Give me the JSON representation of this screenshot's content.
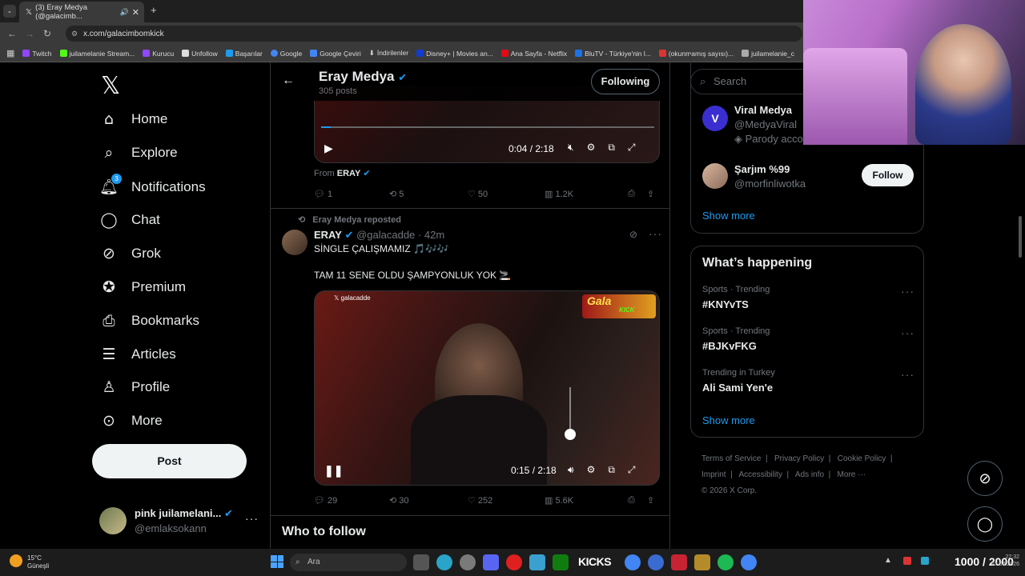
{
  "browser": {
    "tab_title": "(3) Eray Medya (@galacimb...",
    "url": "x.com/galacimbomkick",
    "bookmarks": [
      "Twitch",
      "juilamelanie Stream...",
      "Kurucu",
      "Unfollow",
      "Başarılar",
      "Google",
      "Google Çeviri",
      "İndirilenler",
      "Disney+ | Movies an...",
      "Ana Sayfa - Netflix",
      "BluTV - Türkiye'nin l...",
      "(okunmamış sayısı)...",
      "juilamelanie_c"
    ]
  },
  "sidebar": {
    "items": [
      {
        "label": "Home",
        "icon": "home-icon"
      },
      {
        "label": "Explore",
        "icon": "search-icon"
      },
      {
        "label": "Notifications",
        "icon": "bell-icon",
        "badge": "3"
      },
      {
        "label": "Chat",
        "icon": "chat-icon"
      },
      {
        "label": "Grok",
        "icon": "grok-icon"
      },
      {
        "label": "Premium",
        "icon": "premium-icon"
      },
      {
        "label": "Bookmarks",
        "icon": "bookmark-icon"
      },
      {
        "label": "Articles",
        "icon": "article-icon"
      },
      {
        "label": "Profile",
        "icon": "profile-icon"
      },
      {
        "label": "More",
        "icon": "more-icon"
      }
    ],
    "post_label": "Post",
    "account": {
      "name": "pink juilamelani...",
      "handle": "@emlaksokann"
    }
  },
  "header": {
    "name": "Eray Medya",
    "posts": "305 posts",
    "following_label": "Following"
  },
  "tweet1": {
    "video_time": "0:04 / 2:18",
    "from_label": "From",
    "from_name": "ERAY",
    "replies": "1",
    "reposts": "5",
    "likes": "50",
    "views": "1.2K"
  },
  "tweet2": {
    "repost_label": "Eray Medya reposted",
    "name": "ERAY",
    "handle": "@galacadde",
    "time": "· 42m",
    "line1": "SİNGLE ÇALIŞMAMIZ 🎵🎶🎶",
    "line2": "TAM 11 SENE OLDU ŞAMPYONLUK YOK 🚬",
    "video_time": "0:15 / 2:18",
    "watermark": "galacadde",
    "logo_text": "Gala",
    "logo_kick": "KICK",
    "replies": "29",
    "reposts": "30",
    "likes": "252",
    "views": "5.6K"
  },
  "who_to_follow_title": "Who to follow",
  "search": {
    "placeholder": "Search"
  },
  "suggestions": [
    {
      "name": "Viral Medya",
      "handle": "@MedyaViral",
      "note": "Parody acco"
    },
    {
      "name": "Şarjım %99",
      "handle": "@morfinliwotka",
      "follow_label": "Follow"
    }
  ],
  "show_more": "Show more",
  "trends": {
    "title": "What’s happening",
    "items": [
      {
        "context": "Sports · Trending",
        "name": "#KNYvTS"
      },
      {
        "context": "Sports · Trending",
        "name": "#BJKvFKG"
      },
      {
        "context": "Trending in Turkey",
        "name": "Ali Sami Yen'e"
      }
    ],
    "show_more": "Show more"
  },
  "footer": {
    "row1": [
      "Terms of Service",
      "Privacy Policy",
      "Cookie Policy"
    ],
    "row2": [
      "Imprint",
      "Accessibility",
      "Ads info",
      "More ···"
    ],
    "copyright": "© 2026 X Corp."
  },
  "taskbar": {
    "weather": "15°C",
    "weather_desc": "Güneşli",
    "search_placeholder": "Ara",
    "kicks_label": "KICKS",
    "counter": "1000 / 2000",
    "clock_time": "22:32",
    "clock_date": "27.04.2026"
  },
  "colors": {
    "accent": "#1d9bf0",
    "background": "#000000",
    "border": "#2f3336",
    "muted": "#71767b"
  }
}
